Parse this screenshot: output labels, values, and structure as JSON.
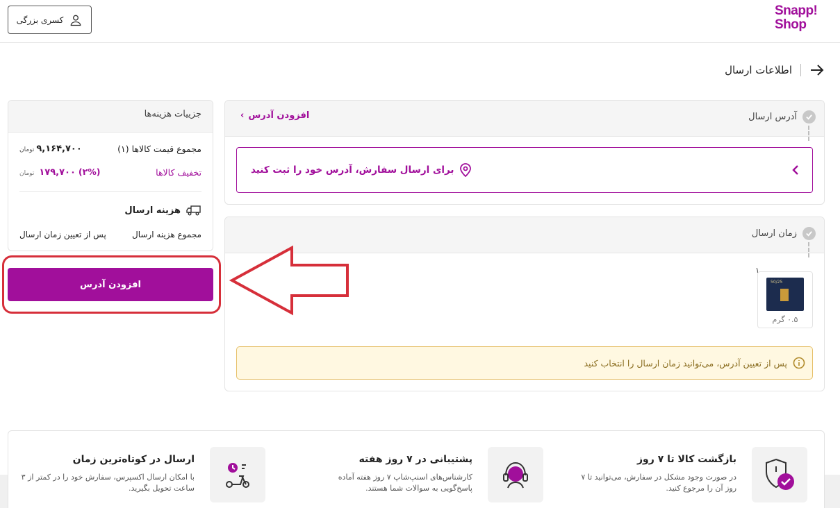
{
  "header": {
    "logo_line1": "Snapp!",
    "logo_line2": "Shop",
    "user_name": "کسری بزرگی"
  },
  "page": {
    "title": "اطلاعات ارسال"
  },
  "address_section": {
    "title": "آدرس ارسال",
    "add_link": "افزودن آدرس",
    "add_link_chevron": "›",
    "prompt": "برای ارسال سفارش، آدرس خود را ثبت کنید"
  },
  "delivery_section": {
    "title": "زمان ارسال",
    "product_qty": "۱",
    "product_weight": "۰.۵ گرم",
    "product_label": "50/25",
    "warning": "پس از تعیین آدرس، می‌توانید زمان ارسال را انتخاب کنید"
  },
  "costs": {
    "title": "جزییات هزینه‌ها",
    "items_label": "مجموع قیمت کالاها (۱)",
    "items_value": "۹,۱۶۴,۷۰۰",
    "currency": "تومان",
    "discount_label": "تخفیف کالاها",
    "discount_percent": "(۲%)",
    "discount_value": "۱۷۹,۷۰۰",
    "shipping_title": "هزینه ارسال",
    "shipping_total_label": "مجموع هزینه ارسال",
    "shipping_total_value": "پس از تعیین زمان ارسال",
    "cta": "افزودن آدرس"
  },
  "features": [
    {
      "title": "بازگشت کالا تا ۷ روز",
      "desc": "در صورت وجود مشکل در سفارش، می‌توانید تا ۷ روز آن را مرجوع کنید."
    },
    {
      "title": "پشتیبانی در ۷ روز هفته",
      "desc": "کارشناس‌های اسنپ‌شاپ ۷ روز هفته آماده پاسخ‌گویی به سوالات شما هستند."
    },
    {
      "title": "ارسال در کوتاه‌ترین زمان",
      "desc": "با امکان ارسال اکسپرس، سفارش خود را در کمتر از ۳ ساعت تحویل بگیرید."
    }
  ],
  "colors": {
    "brand": "#a10f9b",
    "annotation": "#d62f3a",
    "warning_bg": "#fff8e1"
  }
}
